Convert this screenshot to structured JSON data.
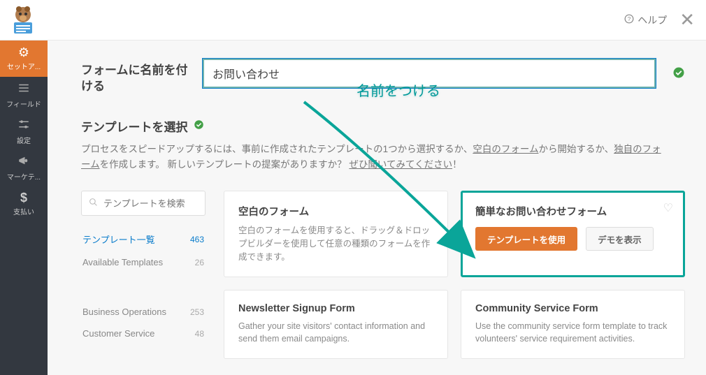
{
  "header": {
    "help_label": "ヘルプ"
  },
  "sidebar": {
    "items": [
      {
        "label": "セットア..."
      },
      {
        "label": "フィールド"
      },
      {
        "label": "設定"
      },
      {
        "label": "マーケテ..."
      },
      {
        "label": "支払い"
      }
    ]
  },
  "form_name": {
    "label": "フォームに名前を付ける",
    "value": "お問い合わせ"
  },
  "templates_section": {
    "title": "テンプレートを選択",
    "desc_prefix": "プロセスをスピードアップするには、事前に作成されたテンプレートの1つから選択するか、",
    "link_blank": "空白のフォーム",
    "desc_mid": "から開始するか、",
    "link_custom": "独自のフォーム",
    "desc_suffix": "を作成します。 新しいテンプレートの提案がありますか？",
    "link_suggest": "ぜひ聞いてみてください",
    "desc_end": "！"
  },
  "search": {
    "placeholder": "テンプレートを検索"
  },
  "categories": [
    {
      "label": "テンプレート一覧",
      "count": "463"
    },
    {
      "label": "Available Templates",
      "count": "26"
    },
    {
      "label": "Business Operations",
      "count": "253"
    },
    {
      "label": "Customer Service",
      "count": "48"
    }
  ],
  "cards": {
    "blank": {
      "title": "空白のフォーム",
      "desc": "空白のフォームを使用すると、ドラッグ＆ドロップビルダーを使用して任意の種類のフォームを作成できます。"
    },
    "contact": {
      "title": "簡単なお問い合わせフォーム",
      "use_btn": "テンプレートを使用",
      "demo_btn": "デモを表示"
    },
    "newsletter": {
      "title": "Newsletter Signup Form",
      "desc": "Gather your site visitors' contact information and send them email campaigns."
    },
    "community": {
      "title": "Community Service Form",
      "desc": "Use the community service form template to track volunteers' service requirement activities."
    }
  },
  "annotation": "名前をつける"
}
